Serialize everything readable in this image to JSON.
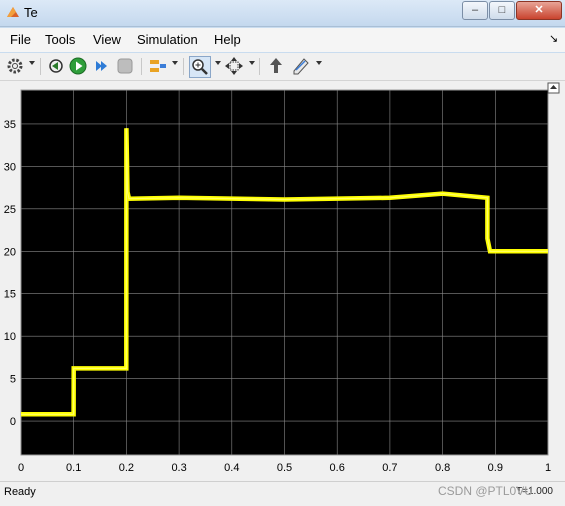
{
  "window": {
    "title": "Te",
    "minimize": "–",
    "maximize": "□",
    "close": "✕"
  },
  "menu": [
    "File",
    "Tools",
    "View",
    "Simulation",
    "Help"
  ],
  "menu_extra": "↘",
  "toolbar": {
    "icons": [
      "gear-icon",
      "step-back-icon",
      "run-icon",
      "step-forward-icon",
      "stop-icon",
      "signal-select-icon",
      "zoom-icon",
      "fit-to-view-icon",
      "highlight-block-icon",
      "style-icon"
    ]
  },
  "colors": {
    "axes_bg": "#000000",
    "signal": "#ffff00",
    "grid": "#8a8a8a",
    "tick_text": "#ffffff"
  },
  "chart_data": {
    "type": "line",
    "title": "",
    "xlabel": "",
    "ylabel": "",
    "xlim": [
      0,
      1
    ],
    "ylim": [
      -4,
      39
    ],
    "xticks": [
      "0",
      "0.1",
      "0.2",
      "0.3",
      "0.4",
      "0.5",
      "0.6",
      "0.7",
      "0.8",
      "0.9",
      "1"
    ],
    "yticks": [
      "0",
      "5",
      "10",
      "15",
      "20",
      "25",
      "30",
      "35"
    ],
    "grid": true,
    "series": [
      {
        "x": [
          0,
          0.0999,
          0.1,
          0.1999,
          0.2,
          0.202,
          0.205,
          0.3,
          0.5,
          0.7,
          0.8,
          0.885,
          0.8851,
          0.89,
          1.0
        ],
        "y": [
          0.8,
          0.8,
          6.2,
          6.2,
          34.5,
          27.0,
          26.2,
          26.3,
          26.1,
          26.3,
          26.8,
          26.3,
          21.5,
          20.0,
          20.0
        ]
      }
    ]
  },
  "status": {
    "state": "Ready",
    "time": "T=1.000"
  },
  "watermark": "CSDN @PTL0VU"
}
